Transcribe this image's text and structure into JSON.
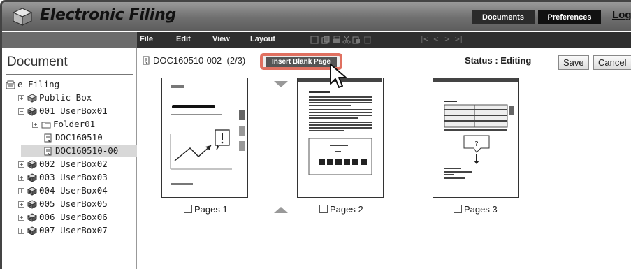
{
  "header": {
    "app_title": "Electronic Filing",
    "tabs": [
      "Documents",
      "Preferences"
    ],
    "login": "Logi"
  },
  "menubar": {
    "items": [
      "File",
      "Edit",
      "View",
      "Layout"
    ],
    "icons": [
      "select-icon",
      "copy-icon",
      "print-icon",
      "cut-icon",
      "paste-icon",
      "delete-icon",
      "first-page-icon",
      "prev-page-icon",
      "next-page-icon",
      "last-page-icon"
    ]
  },
  "sidebar": {
    "title": "Document",
    "tree": [
      {
        "label": "e-Filing",
        "icon": "efiling-icon",
        "expander": "",
        "selected": false
      },
      {
        "label": "Public Box",
        "icon": "public-box-icon",
        "expander": "+",
        "selected": false
      },
      {
        "label": "001 UserBox01",
        "icon": "userbox-icon",
        "expander": "-",
        "selected": false
      },
      {
        "label": "Folder01",
        "icon": "folder-icon",
        "expander": "+",
        "selected": false
      },
      {
        "label": "DOC160510",
        "icon": "document-icon",
        "expander": "",
        "selected": false
      },
      {
        "label": "DOC160510-00",
        "icon": "document-icon",
        "expander": "",
        "selected": true
      },
      {
        "label": "002 UserBox02",
        "icon": "userbox-icon",
        "expander": "+",
        "selected": false
      },
      {
        "label": "003 UserBox03",
        "icon": "userbox-icon",
        "expander": "+",
        "selected": false
      },
      {
        "label": "004 UserBox04",
        "icon": "userbox-icon",
        "expander": "+",
        "selected": false
      },
      {
        "label": "005 UserBox05",
        "icon": "userbox-icon",
        "expander": "+",
        "selected": false
      },
      {
        "label": "006 UserBox06",
        "icon": "userbox-icon",
        "expander": "+",
        "selected": false
      },
      {
        "label": "007 UserBox07",
        "icon": "userbox-icon",
        "expander": "+",
        "selected": false
      }
    ]
  },
  "main": {
    "doc_name": "DOC160510-002",
    "page_info": "(2/3)",
    "insert_button": "Insert Blank Page",
    "status": "Status : Editing",
    "save": "Save",
    "cancel": "Cancel",
    "pages": [
      {
        "label": "Pages 1",
        "checked": false
      },
      {
        "label": "Pages 2",
        "checked": false
      },
      {
        "label": "Pages 3",
        "checked": false
      }
    ],
    "thumb3_text": "?"
  },
  "colors": {
    "header_dark": "#5d5d5d",
    "menubar": "#2f2f2f",
    "highlight": "#e07060"
  }
}
